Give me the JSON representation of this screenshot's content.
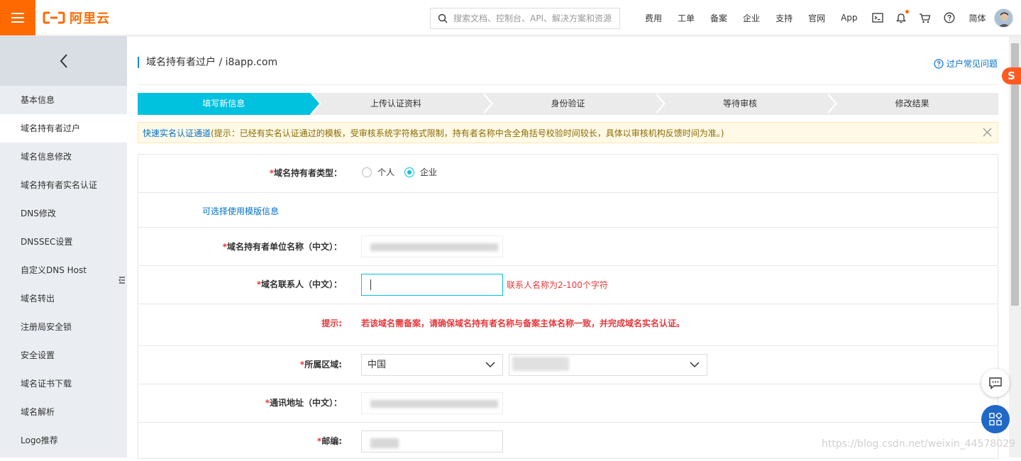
{
  "header": {
    "logo_text": "阿里云",
    "search_placeholder": "搜索文档、控制台、API、解决方案和资源",
    "nav_items": [
      "费用",
      "工单",
      "备案",
      "企业",
      "支持",
      "官网",
      "App"
    ],
    "lang": "简体",
    "accent_color": "#ff6a00"
  },
  "sidebar": {
    "items": [
      "基本信息",
      "域名持有者过户",
      "域名信息修改",
      "域名持有者实名认证",
      "DNS修改",
      "DNSSEC设置",
      "自定义DNS Host",
      "域名转出",
      "注册局安全锁",
      "安全设置",
      "域名证书下载",
      "域名解析",
      "Logo推荐"
    ],
    "active_index": 1
  },
  "page": {
    "title": "域名持有者过户 / i8app.com",
    "help_link": "过户常见问题"
  },
  "steps": [
    "填写新信息",
    "上传认证资料",
    "身份验证",
    "等待审核",
    "修改结果"
  ],
  "notice": {
    "link": "快速实名认证通道",
    "text": "(提示：已经有实名认证通过的模板，受审核系统字符格式限制，持有者名称中含全角括号校验时间较长，具体以审核机构反馈时间为准。)"
  },
  "form": {
    "holder_type_label": "域名持有者类型：",
    "holder_type_options": [
      "个人",
      "企业"
    ],
    "holder_type_selected": "企业",
    "template_link": "可选择使用模版信息",
    "org_name_label": "域名持有者单位名称（中文）：",
    "contact_label": "域名联系人（中文）：",
    "contact_error": "联系人名称为2-100个字符",
    "tip_label": "提示:",
    "tip_text": "若该域名需备案，请确保域名持有者名称与备案主体名称一致，并完成域名实名认证。",
    "region_label": "所属区域:",
    "region_country": "中国",
    "address_label": "通讯地址（中文）：",
    "zip_label": "邮编:"
  },
  "watermark": "https://blog.csdn.net/weixin_44578029",
  "sogou_icon": "S"
}
